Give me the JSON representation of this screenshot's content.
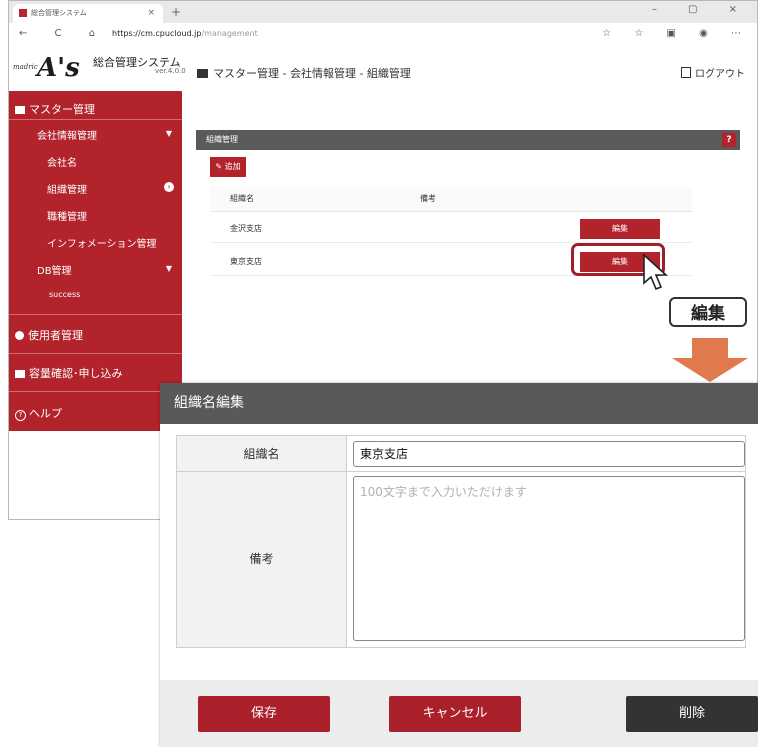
{
  "browser": {
    "tab_title": "総合管理システム",
    "tab_close": "×",
    "new_tab": "+",
    "window_controls": "–  ▢  ×",
    "nav_buttons": "← C ⌂",
    "url_host": "https://cm.cpucloud.jp",
    "url_path": "/management",
    "addr_icons": "☆ ☆ ▣ ◉ ⋯"
  },
  "app": {
    "logo_small": "madric",
    "logo_big": "A's",
    "system_name": "総合管理システム",
    "version": "ver.4.0.0",
    "breadcrumb": "マスター管理 - 会社情報管理 - 組織管理",
    "logout": "ログアウト"
  },
  "sidebar": {
    "master": "マスター管理",
    "company_info": "会社情報管理",
    "company_name": "会社名",
    "org": "組織管理",
    "job": "職種管理",
    "information": "インフォメーション管理",
    "db": "DB管理",
    "success": "success",
    "users": "使用者管理",
    "capacity": "容量確認･申し込み",
    "help": "ヘルプ"
  },
  "panel": {
    "title": "組織管理",
    "help": "?",
    "add": "追加",
    "col_name": "組織名",
    "col_note": "備考",
    "rows": [
      {
        "name": "金沢支店",
        "edit": "編集"
      },
      {
        "name": "東京支店",
        "edit": "編集"
      }
    ]
  },
  "callout": "編集",
  "colors": {
    "accent": "#b3232c",
    "dark": "#595959",
    "arrow": "#e07a4d"
  },
  "dialog": {
    "title": "組織名編集",
    "name_label": "組織名",
    "name_value": "東京支店",
    "note_label": "備考",
    "note_placeholder": "100文字まで入力いただけます",
    "save": "保存",
    "cancel": "キャンセル",
    "delete": "削除"
  }
}
